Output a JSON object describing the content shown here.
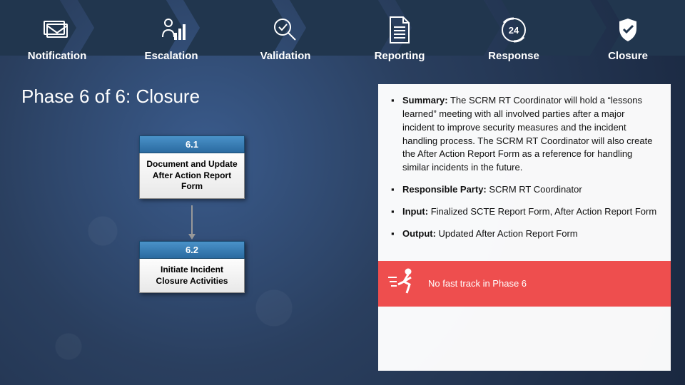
{
  "phases": [
    {
      "label": "Notification"
    },
    {
      "label": "Escalation"
    },
    {
      "label": "Validation"
    },
    {
      "label": "Reporting"
    },
    {
      "label": "Response"
    },
    {
      "label": "Closure"
    }
  ],
  "title": "Phase 6 of 6:  Closure",
  "flow": {
    "step1": {
      "num": "6.1",
      "text": "Document and Update After Action Report Form"
    },
    "step2": {
      "num": "6.2",
      "text": "Initiate Incident Closure Activities"
    }
  },
  "bullets": {
    "summary_label": "Summary:",
    "summary_text": "  The SCRM RT Coordinator will hold a “lessons learned” meeting with all involved parties after a major incident to improve security measures and the incident handling process.  The SCRM RT Coordinator will also create the After Action Report Form as a reference for handling similar incidents in the future.",
    "resp_label": "Responsible Party:",
    "resp_text": "  SCRM RT Coordinator",
    "input_label": "Input:",
    "input_text": "  Finalized SCTE Report Form, After Action Report Form",
    "output_label": "Output:",
    "output_text": "  Updated After Action Report Form"
  },
  "fast_track": "No fast track in Phase 6",
  "response_badge": "24"
}
